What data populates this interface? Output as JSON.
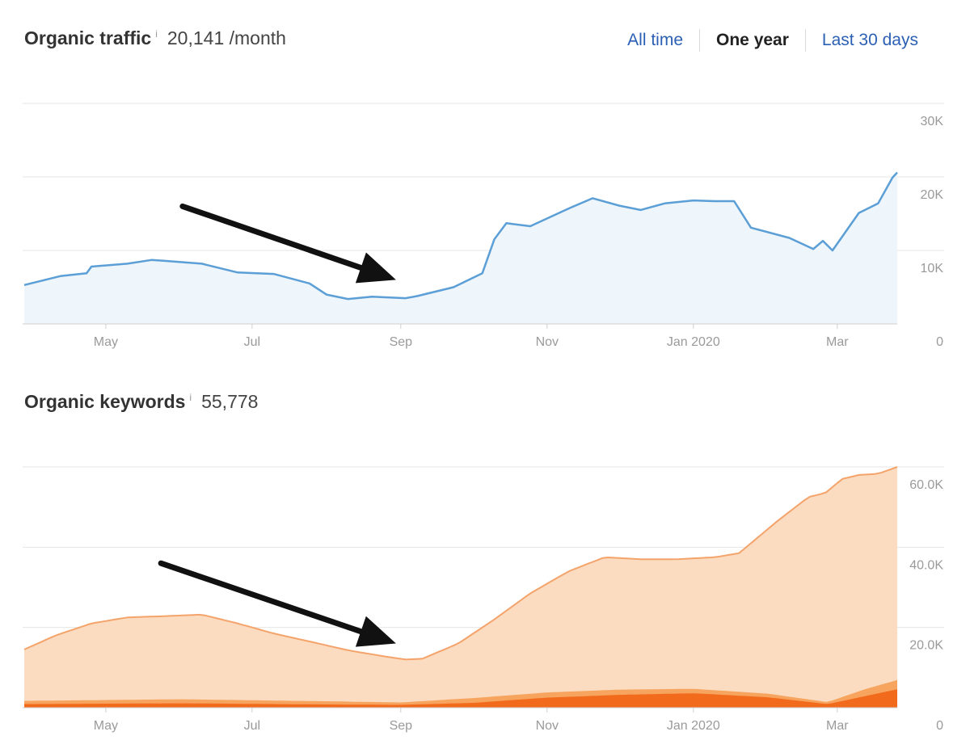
{
  "traffic_header": {
    "title": "Organic traffic",
    "info": "i",
    "value": "20,141 /month"
  },
  "keywords_header": {
    "title": "Organic keywords",
    "info": "i",
    "value": "55,778"
  },
  "range_tabs": [
    {
      "label": "All time",
      "active": false
    },
    {
      "label": "One year",
      "active": true
    },
    {
      "label": "Last 30 days",
      "active": false
    }
  ],
  "colors": {
    "traffic_line": "#5b9fd6",
    "traffic_fill": "#eef5fb",
    "keywords_top": "#fbdcc0",
    "keywords_top_line": "#f4a36b",
    "keywords_mid": "#f7a45f",
    "keywords_bottom": "#f26b1d",
    "arrow": "#111111",
    "grid": "#e6e6e6"
  },
  "chart_data": [
    {
      "type": "area",
      "name": "organic-traffic",
      "x_tick_labels": [
        "May",
        "Jul",
        "Sep",
        "Nov",
        "Jan 2020",
        "Mar"
      ],
      "x_tick_dates": [
        "2019-05-01",
        "2019-07-01",
        "2019-09-01",
        "2019-11-01",
        "2020-01-01",
        "2020-03-01"
      ],
      "x_range": [
        "2019-03-28",
        "2020-03-26"
      ],
      "y_tick_labels": [
        "0",
        "10K",
        "20K",
        "30K"
      ],
      "y_ticks": [
        0,
        10000,
        20000,
        30000
      ],
      "ylim": [
        0,
        30000
      ],
      "grid": true,
      "series": [
        {
          "dates": [
            "2019-03-28",
            "2019-04-12",
            "2019-04-23",
            "2019-04-25",
            "2019-05-10",
            "2019-05-20",
            "2019-05-25",
            "2019-06-10",
            "2019-06-25",
            "2019-07-10",
            "2019-07-25",
            "2019-08-01",
            "2019-08-10",
            "2019-08-20",
            "2019-09-03",
            "2019-09-08",
            "2019-09-23",
            "2019-10-05",
            "2019-10-10",
            "2019-10-15",
            "2019-10-25",
            "2019-11-10",
            "2019-11-20",
            "2019-12-01",
            "2019-12-10",
            "2019-12-20",
            "2020-01-01",
            "2020-01-10",
            "2020-01-18",
            "2020-01-25",
            "2020-02-10",
            "2020-02-20",
            "2020-02-24",
            "2020-02-28",
            "2020-03-10",
            "2020-03-18",
            "2020-03-24",
            "2020-03-26"
          ],
          "values": [
            5300,
            6500,
            6900,
            7800,
            8200,
            8700,
            8600,
            8200,
            7000,
            6800,
            5500,
            4000,
            3400,
            3700,
            3500,
            3800,
            5000,
            6900,
            11500,
            13700,
            13300,
            15700,
            17100,
            16100,
            15500,
            16400,
            16800,
            16700,
            16700,
            13100,
            11700,
            10200,
            11300,
            10000,
            15100,
            16400,
            19900,
            20600
          ]
        }
      ],
      "annotations": [
        {
          "type": "arrow",
          "from_date": "2019-06-02",
          "from_value": 16000,
          "to_date": "2019-08-30",
          "to_value": 6000
        }
      ]
    },
    {
      "type": "area",
      "name": "organic-keywords",
      "stacked": true,
      "x_tick_labels": [
        "May",
        "Jul",
        "Sep",
        "Nov",
        "Jan 2020",
        "Mar"
      ],
      "x_tick_dates": [
        "2019-05-01",
        "2019-07-01",
        "2019-09-01",
        "2019-11-01",
        "2020-01-01",
        "2020-03-01"
      ],
      "x_range": [
        "2019-03-28",
        "2020-03-26"
      ],
      "y_tick_labels": [
        "0",
        "20.0K",
        "40.0K",
        "60.0K"
      ],
      "y_ticks": [
        0,
        20000,
        40000,
        60000
      ],
      "ylim": [
        0,
        60000
      ],
      "grid": true,
      "series": [
        {
          "band": "top",
          "dates": [
            "2019-03-28",
            "2019-04-10",
            "2019-04-25",
            "2019-05-10",
            "2019-05-25",
            "2019-06-10",
            "2019-06-25",
            "2019-07-10",
            "2019-07-25",
            "2019-08-10",
            "2019-08-25",
            "2019-09-03",
            "2019-09-10",
            "2019-09-25",
            "2019-10-10",
            "2019-10-25",
            "2019-11-10",
            "2019-11-25",
            "2019-12-10",
            "2019-12-25",
            "2020-01-10",
            "2020-01-20",
            "2020-02-05",
            "2020-02-18",
            "2020-02-25",
            "2020-03-03",
            "2020-03-10",
            "2020-03-18",
            "2020-03-26"
          ],
          "values": [
            14500,
            18000,
            21000,
            22500,
            22800,
            23200,
            21000,
            18500,
            16500,
            14300,
            12800,
            12000,
            12200,
            16000,
            22000,
            28500,
            34000,
            37500,
            37000,
            37000,
            37500,
            38500,
            46500,
            52500,
            53500,
            57000,
            58000,
            58300,
            60000
          ]
        },
        {
          "band": "middle",
          "dates": [
            "2019-03-28",
            "2019-06-01",
            "2019-08-01",
            "2019-09-01",
            "2019-10-01",
            "2019-11-01",
            "2019-12-01",
            "2020-01-01",
            "2020-02-01",
            "2020-02-26",
            "2020-03-12",
            "2020-03-26"
          ],
          "values": [
            1700,
            2100,
            1600,
            1300,
            2400,
            3800,
            4500,
            4700,
            3500,
            1400,
            4500,
            6900
          ]
        },
        {
          "band": "bottom",
          "dates": [
            "2019-03-28",
            "2019-06-01",
            "2019-08-01",
            "2019-09-01",
            "2019-10-01",
            "2019-11-01",
            "2019-12-01",
            "2020-01-01",
            "2020-02-01",
            "2020-02-26",
            "2020-03-12",
            "2020-03-26"
          ],
          "values": [
            900,
            1100,
            800,
            700,
            1200,
            2500,
            3200,
            3600,
            2600,
            900,
            2800,
            4600
          ]
        }
      ],
      "annotations": [
        {
          "type": "arrow",
          "from_date": "2019-05-24",
          "from_value": 36000,
          "to_date": "2019-08-30",
          "to_value": 16000
        }
      ]
    }
  ]
}
